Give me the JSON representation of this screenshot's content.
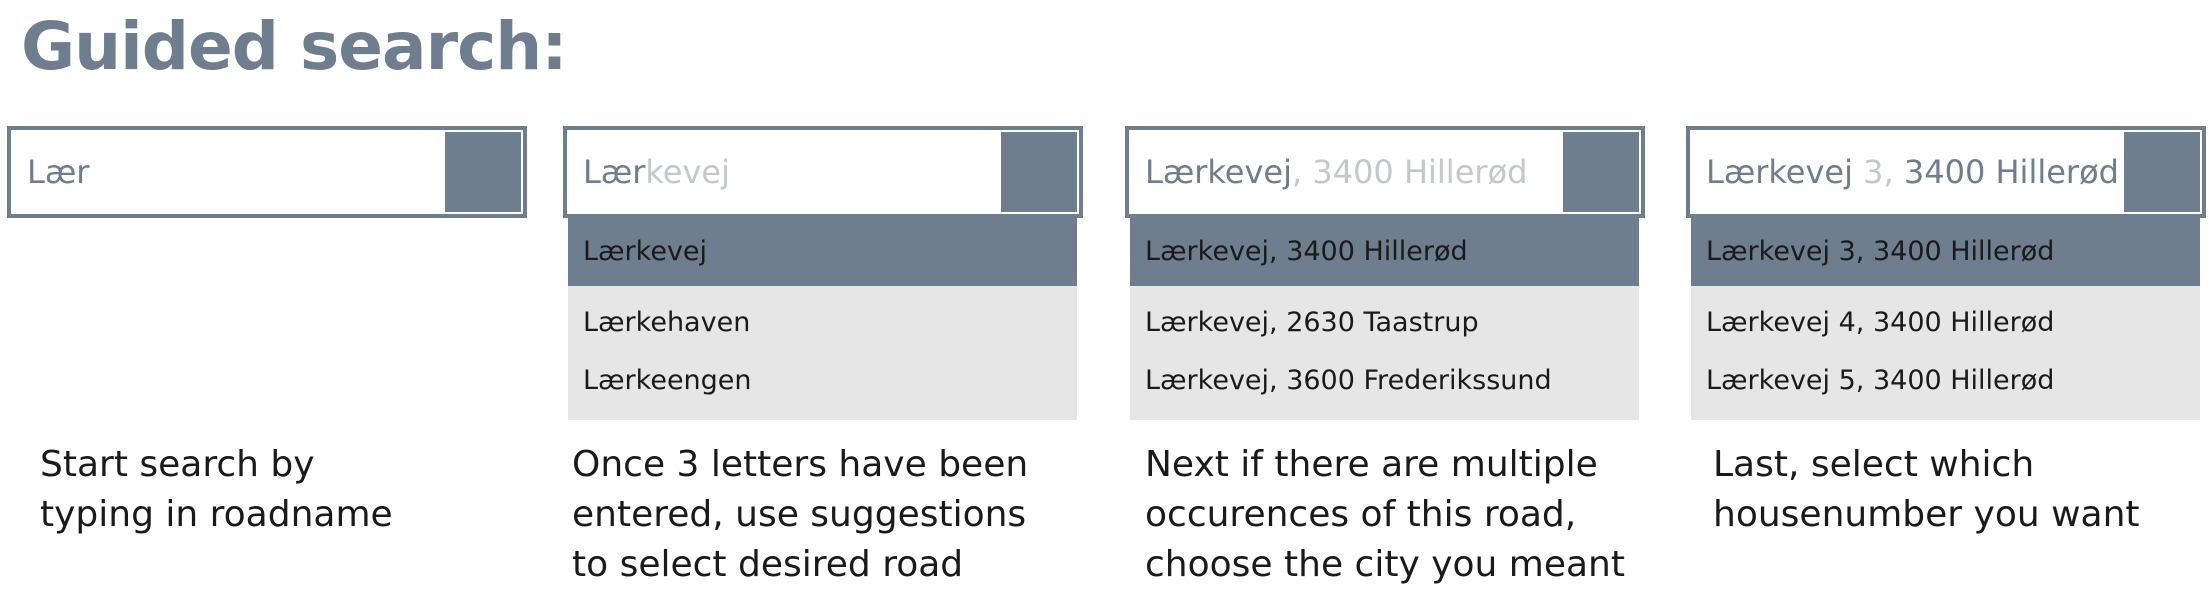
{
  "title": "Guided search:",
  "steps": [
    {
      "input_typed": "Lær",
      "input_ghost": "",
      "input_tail": "",
      "suggestions": [],
      "caption": [
        "Start search by",
        "typing in roadname"
      ]
    },
    {
      "input_typed": "Lær",
      "input_ghost": "kevej",
      "input_tail": "",
      "suggestions": [
        "Lærkevej",
        "Lærkehaven",
        "Lærkeengen"
      ],
      "selected_index": 0,
      "caption": [
        "Once 3 letters have been",
        "entered, use suggestions",
        "to select desired road"
      ]
    },
    {
      "input_typed": "Lærkevej",
      "input_ghost": ", 3400 Hillerød",
      "input_tail": "",
      "suggestions": [
        "Lærkevej, 3400 Hillerød",
        "Lærkevej, 2630 Taastrup",
        "Lærkevej, 3600 Frederikssund"
      ],
      "selected_index": 0,
      "caption": [
        "Next if there are multiple",
        "occurences of this road,",
        "choose the city you meant"
      ]
    },
    {
      "input_typed": "Lærkevej",
      "input_ghost": " 3,",
      "input_tail": " 3400 Hillerød",
      "suggestions": [
        "Lærkevej 3, 3400 Hillerød",
        "Lærkevej 4, 3400 Hillerød",
        "Lærkevej 5, 3400 Hillerød"
      ],
      "selected_index": 0,
      "caption": [
        "Last, select which",
        "housenumber you want"
      ]
    }
  ],
  "colors": {
    "accent": "#6f7e8e",
    "ghost_text": "#c3c8cf",
    "dropdown_bg": "#e6e6e6"
  }
}
